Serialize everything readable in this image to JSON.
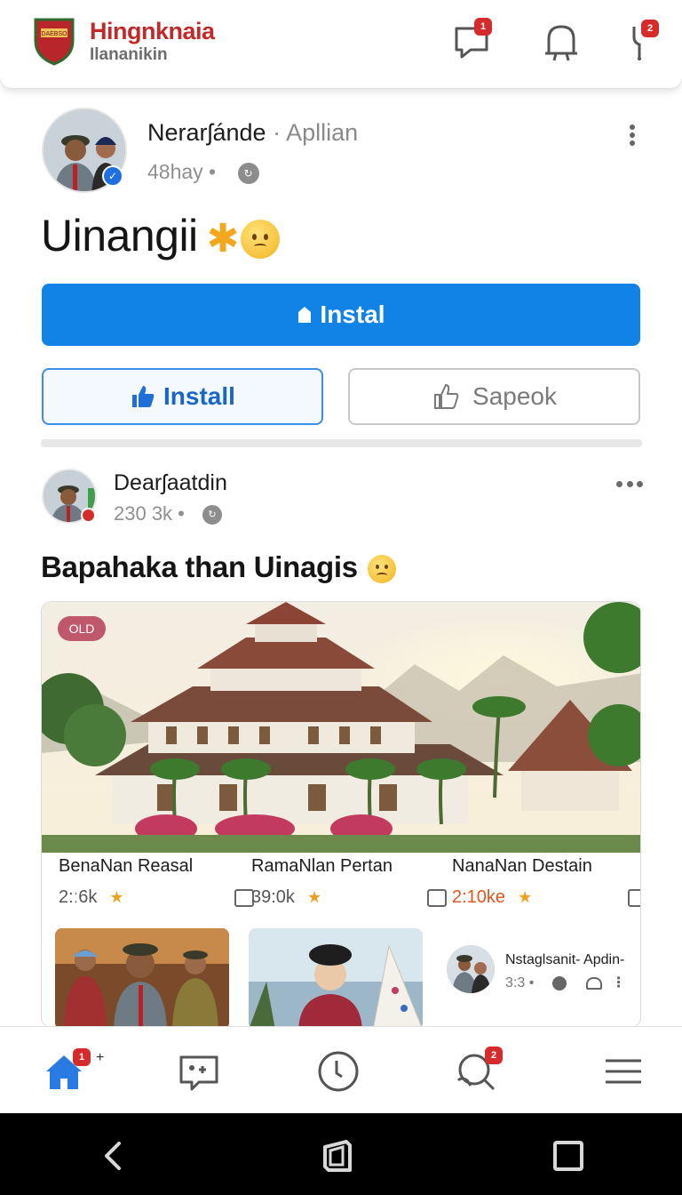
{
  "header": {
    "logo_text": "DAEBSO",
    "title": "Hingnknaia",
    "subtitle": "Ilananikin",
    "icons": [
      {
        "name": "chat-icon",
        "badge": "1"
      },
      {
        "name": "bell-icon",
        "badge": ""
      },
      {
        "name": "tool-icon",
        "badge": "2"
      }
    ]
  },
  "post1": {
    "author": "Nerarʃánde",
    "author_sub": "· Apllian",
    "time": "48hay •",
    "title": "Uinangii",
    "primary_button": "Instal",
    "like_button": "Install",
    "secondary_button": "Sapeok"
  },
  "post2": {
    "author": "Dearʃaatdin",
    "meta": "230 3k •",
    "title": "Bapahaka than Uinagis",
    "image_tag": "OLD",
    "locations": [
      {
        "name": "BenaNan Reasal",
        "value": "2:ː6k"
      },
      {
        "name": "RamaNlan Pertan",
        "value": "39:0k"
      },
      {
        "name": "NanaNan Destain",
        "value": "2:10ke"
      }
    ],
    "mini_user": {
      "name": "Nstaglsanit- Apdin-",
      "meta": "3:3 •"
    }
  },
  "bottom_nav": [
    {
      "name": "home-icon",
      "badge": "1"
    },
    {
      "name": "photo-icon",
      "badge": ""
    },
    {
      "name": "clock-icon",
      "badge": ""
    },
    {
      "name": "search-icon",
      "badge": "2"
    },
    {
      "name": "menu-icon",
      "badge": ""
    }
  ],
  "colors": {
    "brand_red": "#c22a2a",
    "primary_blue": "#1182e6",
    "badge_red": "#d62b2b"
  }
}
